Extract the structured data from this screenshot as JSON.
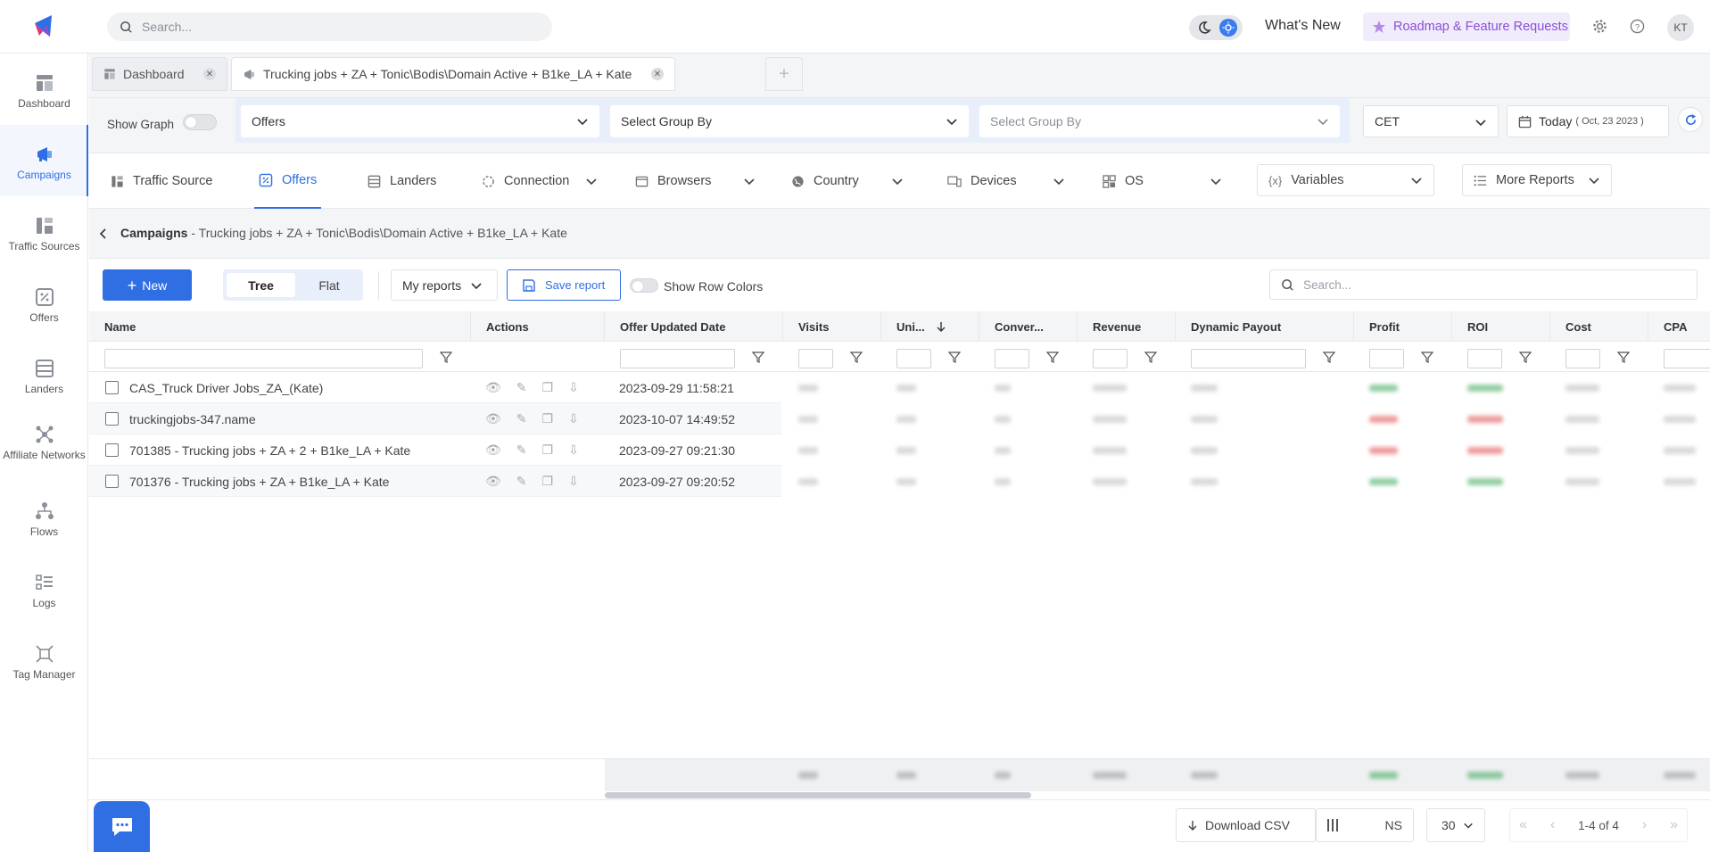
{
  "topbar": {
    "search_placeholder": "Search...",
    "whats_new": "What's New",
    "roadmap": "Roadmap & Feature Requests",
    "avatar_initials": "KT"
  },
  "sidebar": {
    "items": [
      {
        "label": "Dashboard"
      },
      {
        "label": "Campaigns"
      },
      {
        "label": "Traffic Sources"
      },
      {
        "label": "Offers"
      },
      {
        "label": "Landers"
      },
      {
        "label": "Affiliate Networks"
      },
      {
        "label": "Flows"
      },
      {
        "label": "Logs"
      },
      {
        "label": "Tag Manager"
      }
    ]
  },
  "tabs": [
    {
      "label": "Dashboard"
    },
    {
      "label": "Trucking jobs + ZA + Tonic\\Bodis\\Domain Active + B1ke_LA + Kate"
    }
  ],
  "filters": {
    "show_graph": "Show Graph",
    "group1": "Offers",
    "group2": "Select Group By",
    "group3": "Select Group By",
    "timezone": "CET",
    "date_label": "Today",
    "date_value": "( Oct, 23 2023 )"
  },
  "report_tabs": {
    "traffic_source": "Traffic Source",
    "offers": "Offers",
    "landers": "Landers",
    "connection": "Connection",
    "browsers": "Browsers",
    "country": "Country",
    "devices": "Devices",
    "os": "OS",
    "variables": "Variables",
    "more_reports": "More Reports"
  },
  "breadcrumb": {
    "root": "Campaigns",
    "path": " - Trucking jobs + ZA + Tonic\\Bodis\\Domain Active + B1ke_LA + Kate"
  },
  "toolbar": {
    "new": "New",
    "tree": "Tree",
    "flat": "Flat",
    "my_reports": "My reports",
    "save_report": "Save report",
    "show_row_colors": "Show Row Colors",
    "search_placeholder": "Search..."
  },
  "grid": {
    "columns": [
      "Name",
      "Actions",
      "Offer Updated Date",
      "Visits",
      "Uni...",
      "Conver...",
      "Revenue",
      "Dynamic Payout",
      "Profit",
      "ROI",
      "Cost",
      "CPA"
    ],
    "rows": [
      {
        "name": "CAS_Truck Driver Jobs_ZA_(Kate)",
        "date": "2023-09-29 11:58:21"
      },
      {
        "name": "truckingjobs-347.name",
        "date": "2023-10-07 14:49:52"
      },
      {
        "name": "701385 - Trucking jobs + ZA + 2 + B1ke_LA + Kate",
        "date": "2023-09-27 09:21:30"
      },
      {
        "name": "701376 - Trucking jobs + ZA + B1ke_LA + Kate",
        "date": "2023-09-27 09:20:52"
      }
    ]
  },
  "bottom": {
    "download_csv": "Download CSV",
    "ns": "NS",
    "page_size": "30",
    "page_info": "1-4 of 4"
  },
  "colors": {
    "accent": "#2f6fe3",
    "roadmap": "#8a4fd8",
    "profit_green": "#3aa657",
    "loss_red": "#e24a4a"
  }
}
